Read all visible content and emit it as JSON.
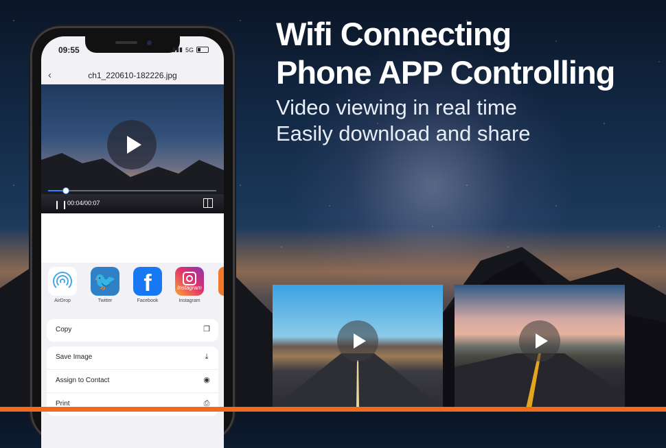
{
  "headline": {
    "line1": "Wifi Connecting",
    "line2": "Phone APP Controlling",
    "sub1": "Video viewing in real time",
    "sub2": "Easily download and share"
  },
  "phone": {
    "status": {
      "time": "09:55",
      "network": "5G"
    },
    "nav": {
      "back_icon": "chevron-left-icon",
      "title": "ch1_220610-182226.jpg"
    },
    "video": {
      "current_time": "00:04",
      "duration": "00:07",
      "time_display": "00:04/00:07",
      "progress_fraction": 0.1
    },
    "share_targets": [
      {
        "label": "AirDrop",
        "icon": "airdrop-icon"
      },
      {
        "label": "Twitter",
        "icon": "twitter-icon",
        "glyph": "🐦"
      },
      {
        "label": "Facebook",
        "icon": "facebook-icon",
        "glyph": "f"
      },
      {
        "label": "Instagram",
        "icon": "instagram-icon",
        "word": "Instagram"
      }
    ],
    "actions": [
      {
        "label": "Copy",
        "icon": "copy-icon",
        "glyph": "❐"
      },
      {
        "label": "Save Image",
        "icon": "save-icon",
        "glyph": "⤓"
      },
      {
        "label": "Assign to Contact",
        "icon": "contact-icon",
        "glyph": "◉"
      },
      {
        "label": "Print",
        "icon": "print-icon",
        "glyph": "⎙"
      }
    ]
  },
  "thumbnails": [
    {
      "name": "desert-road-video",
      "play_icon": "play-icon"
    },
    {
      "name": "sunset-road-video",
      "play_icon": "play-icon"
    }
  ],
  "colors": {
    "accent_orange": "#f26a1b",
    "seek_blue": "#3b82f6"
  }
}
